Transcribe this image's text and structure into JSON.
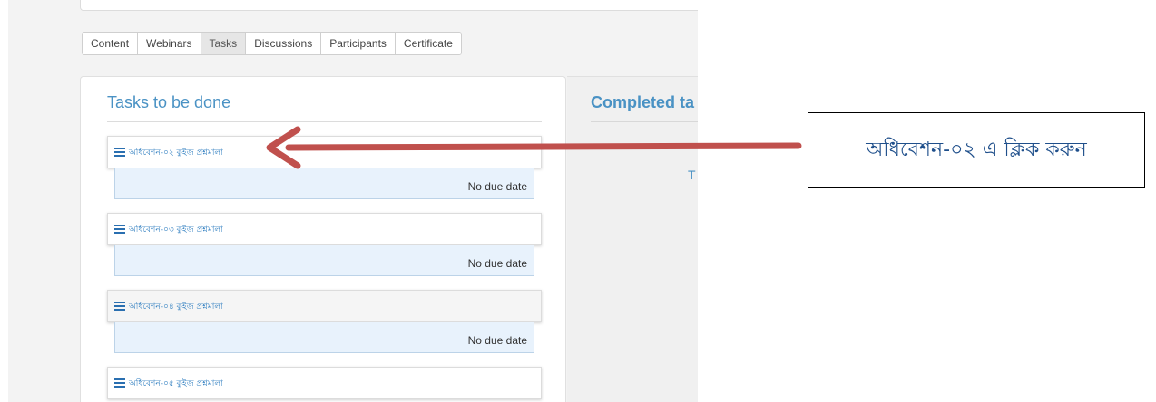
{
  "tabs": [
    {
      "label": "Content",
      "active": false
    },
    {
      "label": "Webinars",
      "active": false
    },
    {
      "label": "Tasks",
      "active": true
    },
    {
      "label": "Discussions",
      "active": false
    },
    {
      "label": "Participants",
      "active": false
    },
    {
      "label": "Certificate",
      "active": false
    }
  ],
  "tasks_panel": {
    "title": "Tasks to be done",
    "items": [
      {
        "title": "অধিবেশন-০২ কুইজ প্রশ্নমালা",
        "due": "No due date",
        "icon": "quiz-stack-icon"
      },
      {
        "title": "অধিবেশন-০৩ কুইজ প্রশ্নমালা",
        "due": "No due date",
        "icon": "quiz-stack-icon"
      },
      {
        "title": "অধিবেশন-০৪ কুইজ প্রশ্নমালা",
        "due": "No due date",
        "icon": "quiz-stack-icon"
      },
      {
        "title": "অধিবেশন-০৫ কুইজ প্রশ্নমালা",
        "icon": "quiz-stack-icon"
      }
    ]
  },
  "completed_panel": {
    "title": "Completed ta",
    "partial_text": "T"
  },
  "callout": {
    "text": "অধিবেশন-০২ এ ক্লিক করুন"
  },
  "colors": {
    "link": "#2f7ec0",
    "title": "#4a92c4",
    "arrow": "#c0504d",
    "due_bg": "#e8f2fc"
  }
}
